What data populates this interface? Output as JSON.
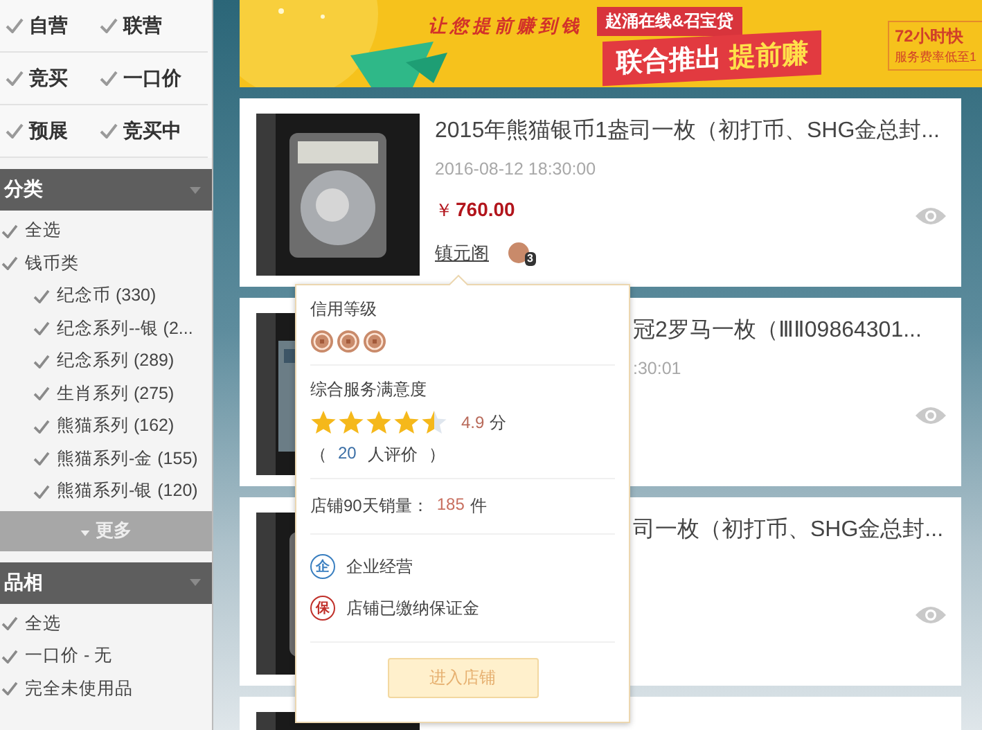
{
  "filters": [
    {
      "label": "自营",
      "checked": true
    },
    {
      "label": "联营",
      "checked": true
    },
    {
      "label": "竞买",
      "checked": true
    },
    {
      "label": "一口价",
      "checked": true
    },
    {
      "label": "预展",
      "checked": true
    },
    {
      "label": "竞买中",
      "checked": true
    }
  ],
  "sections": [
    {
      "title": "分类",
      "items": [
        {
          "label": "全选",
          "checked": true
        },
        {
          "label": "钱币类",
          "checked": true,
          "children": [
            {
              "label": "纪念币 (330)",
              "checked": true
            },
            {
              "label": "纪念系列--银 (2...",
              "checked": true
            },
            {
              "label": "纪念系列 (289)",
              "checked": true
            },
            {
              "label": "生肖系列 (275)",
              "checked": true
            },
            {
              "label": "熊猫系列 (162)",
              "checked": true
            },
            {
              "label": "熊猫系列-金 (155)",
              "checked": true
            },
            {
              "label": "熊猫系列-银 (120)",
              "checked": true
            }
          ]
        }
      ],
      "more": "更多"
    },
    {
      "title": "品相",
      "items": [
        {
          "label": "全选",
          "checked": true
        },
        {
          "label": "一口价 - 无",
          "checked": true
        },
        {
          "label": "完全未使用品",
          "checked": true
        }
      ]
    }
  ],
  "banner": {
    "slogan": "让您提前赚到钱",
    "partners": "赵涌在线&召宝贷",
    "headline": "联合推出",
    "highlight": "提前赚",
    "side_title": "72小时快",
    "side_note": "服务费率低至1"
  },
  "listings": [
    {
      "covered": false,
      "title": "2015年熊猫银币1盎司一枚（初打币、SHG金总封...",
      "time": "2016-08-12 18:30:00",
      "currency": "￥",
      "price": "760.00",
      "seller": "镇元阁",
      "seller_badge": "3"
    },
    {
      "covered": true,
      "title": "冠2罗马一枚（ⅢⅡ09864301...",
      "time": ":30:01"
    },
    {
      "covered": true,
      "title": "司一枚（初打币、SHG金总封..."
    },
    {
      "kind": "stub"
    }
  ],
  "popover": {
    "credit_label": "信用等级",
    "coins": [
      {
        "kind": "copper"
      },
      {
        "kind": "copper"
      },
      {
        "kind": "copper"
      }
    ],
    "satisfaction_label": "综合服务满意度",
    "stars": 4.5,
    "score": "4.9",
    "score_unit": "分",
    "reviews_open": "（",
    "reviews_count": "20",
    "reviews_label": "人评价",
    "reviews_close": "）",
    "sales_label": "店铺90天销量：",
    "sales_count": "185",
    "sales_unit": "件",
    "badges": [
      {
        "kind": "enterprise",
        "icon": "企",
        "label": "企业经营"
      },
      {
        "kind": "deposit",
        "icon": "保",
        "label": "店铺已缴纳保证金"
      }
    ],
    "button": {
      "label": "进入店铺",
      "disabled": true
    }
  }
}
